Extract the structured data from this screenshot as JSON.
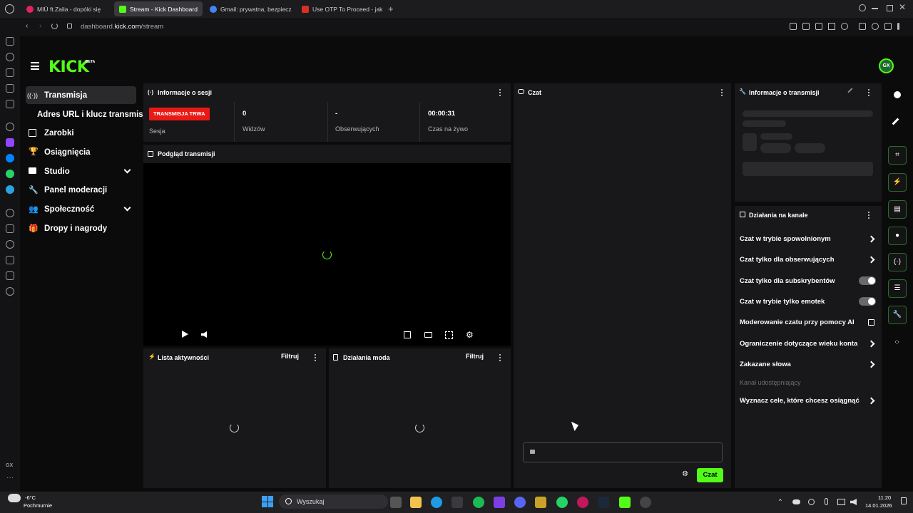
{
  "browser": {
    "tabs": [
      {
        "title": "MIÜ ft.Zalia - dopóki się",
        "color": "#e0245e"
      },
      {
        "title": "Stream - Kick Dashboard",
        "color": "#53fc18"
      },
      {
        "title": "Gmail: prywatna, bezpiecz",
        "color": "#4285f4"
      },
      {
        "title": "Use OTP To Proceed - jak",
        "color": "#d93025"
      }
    ],
    "url_prefix": "dashboard.",
    "url_host": "kick.com",
    "url_path": "/stream"
  },
  "header": {
    "logo": "KICK",
    "logo_badge": "BETA",
    "avatar_text": "GX"
  },
  "sidebar": {
    "items": [
      {
        "label": "Transmisja",
        "icon": "broadcast-icon"
      },
      {
        "label": "Adres URL i klucz transmisji"
      },
      {
        "label": "Zarobki",
        "icon": "chart-icon"
      },
      {
        "label": "Osiągnięcia",
        "icon": "trophy-icon"
      },
      {
        "label": "Studio",
        "icon": "studio-icon"
      },
      {
        "label": "Panel moderacji",
        "icon": "wrench-icon"
      },
      {
        "label": "Społeczność",
        "icon": "community-icon"
      },
      {
        "label": "Dropy i nagrody",
        "icon": "gift-icon"
      }
    ]
  },
  "session": {
    "title": "Informacje o sesji",
    "live_badge": "TRANSMISJA TRWA",
    "session_label": "Sesja",
    "stats": [
      {
        "value": "0",
        "label": "Widzów"
      },
      {
        "value": "-",
        "label": "Obserwujących"
      },
      {
        "value": "00:00:31",
        "label": "Czas na żywo"
      }
    ]
  },
  "preview": {
    "title": "Podgląd transmisji"
  },
  "activity": {
    "title": "Lista aktywności",
    "filter": "Filtruj"
  },
  "modactions": {
    "title": "Działania moda",
    "filter": "Filtruj"
  },
  "chat": {
    "title": "Czat",
    "send_label": "Czat"
  },
  "stream_info": {
    "title": "Informacje o transmisji"
  },
  "channel_actions": {
    "title": "Działania na kanale",
    "rows": [
      {
        "label": "Czat w trybie spowolnionym",
        "control": "chevron"
      },
      {
        "label": "Czat tylko dla obserwujących",
        "control": "chevron"
      },
      {
        "label": "Czat tylko dla subskrybentów",
        "control": "toggle"
      },
      {
        "label": "Czat w trybie tylko emotek",
        "control": "toggle"
      },
      {
        "label": "Moderowanie czatu przy pomocy AI",
        "control": "external"
      },
      {
        "label": "Ograniczenie dotyczące wieku konta",
        "control": "chevron"
      },
      {
        "label": "Zakazane słowa",
        "control": "chevron"
      }
    ],
    "section_label": "Kanał udostępniający",
    "goals_label": "Wyznacz cele, które chcesz osiągnąć"
  },
  "taskbar": {
    "weather_temp": "-6°C",
    "weather_desc": "Pochmurnie",
    "search_placeholder": "Wyszukaj",
    "time": "11:20",
    "date": "14.01.2026"
  },
  "colors": {
    "accent": "#53fc18",
    "live": "#e91916",
    "panel": "#18181a"
  }
}
